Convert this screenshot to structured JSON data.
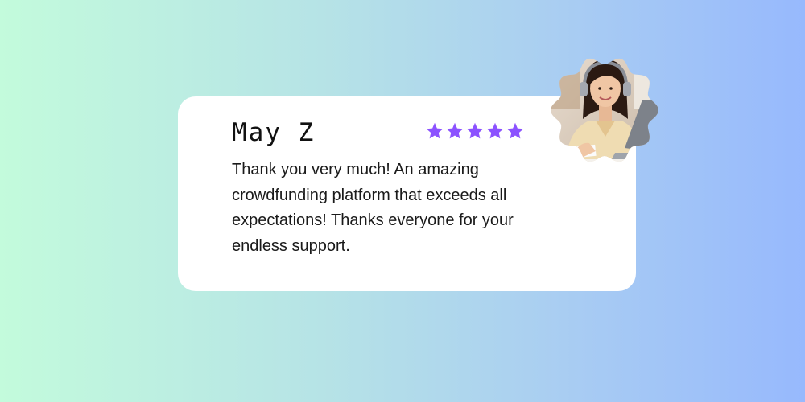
{
  "reviewer": {
    "name": "May Z",
    "rating": 5,
    "max_rating": 5,
    "star_color": "#8c52ff"
  },
  "review": {
    "text": "Thank you very much! An amazing crowdfunding platform that exceeds all expectations! Thanks everyone for your endless support."
  },
  "avatar": {
    "icon": "reviewer-photo"
  },
  "colors": {
    "gradient_start": "#c3fbdc",
    "gradient_end": "#97b9fd",
    "card": "#ffffff"
  }
}
